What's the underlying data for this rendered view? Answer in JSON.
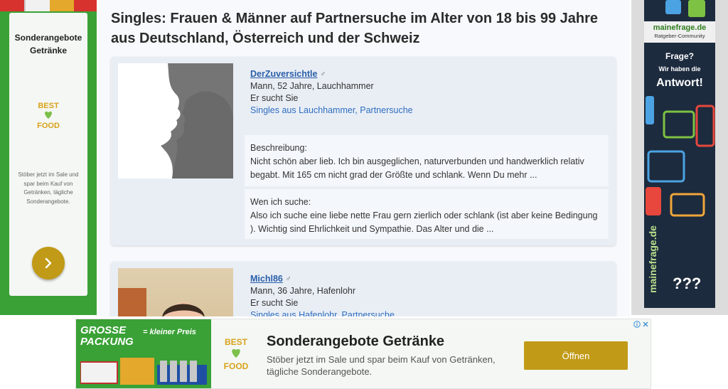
{
  "page": {
    "title": "Singles: Frauen & Männer auf Partnersuche im Alter von 18 bis 99 Jahre aus Deutschland, Österreich und der Schweiz"
  },
  "left_ad": {
    "title": "Sonderangebote Getränke",
    "logo_text_top": "BEST",
    "logo_text_bottom": "FOOD",
    "description": "Stöber jetzt im Sale und spar beim Kauf von Getränken, tägliche Sonderangebote.",
    "button_icon": "chevron-right-icon"
  },
  "profiles": [
    {
      "name": "DerZuversichtle",
      "gender_symbol": "♂",
      "details": "Mann, 52 Jahre, Lauchhammer",
      "seeking": "Er sucht Sie",
      "location_link": "Singles aus Lauchhammer, Partnersuche",
      "description_label": "Beschreibung:",
      "description": "Nicht schön aber lieb. Ich bin ausgeglichen, naturverbunden und handwerklich relativ begabt. Mit 165 cm nicht grad der Größte und schlank. Wenn Du mehr ...",
      "search_label": "Wen ich suche:",
      "search_text": "Also ich suche eine liebe nette Frau gern zierlich oder schlank (ist aber keine Bedingung ). Wichtig sind Ehrlichkeit und Sympathie. Das Alter und die ..."
    },
    {
      "name": "Michl86",
      "gender_symbol": "♂",
      "details": "Mann, 36 Jahre, Hafenlohr",
      "seeking": "Er sucht Sie",
      "location_link": "Singles aus Hafenlohr, Partnersuche"
    }
  ],
  "right_ad": {
    "brand": "mainefrage.de",
    "brand_sub": "Ratgeber-Community",
    "q1": "Frage?",
    "q2": "Wir haben die",
    "q3": "Antwort!",
    "vertical": "mainefrage.de",
    "qmarks": "???"
  },
  "bottom_ad": {
    "promo_line1": "GROSSE",
    "promo_line2": "PACKUNG",
    "promo_suffix": "= kleiner Preis",
    "logo_text_top": "BEST",
    "logo_text_bottom": "FOOD",
    "title": "Sonderangebote Getränke",
    "text": "Stöber jetzt im Sale und spar beim Kauf von Getränken, tägliche Sonderangebote.",
    "cta": "Öffnen"
  },
  "colors": {
    "ad_green": "#3aa136",
    "ad_gold": "#c19a17",
    "link_blue": "#2a5ea8"
  }
}
